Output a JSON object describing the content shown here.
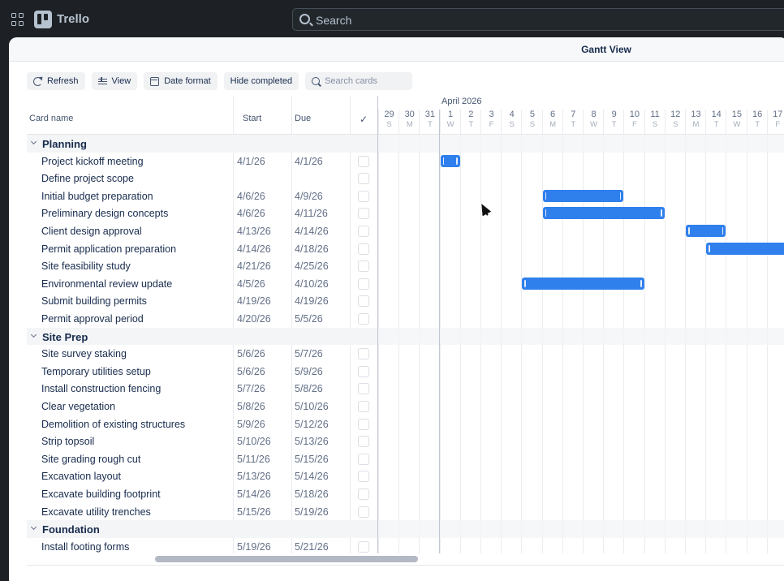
{
  "app": {
    "name": "Trello",
    "search_label": "Search"
  },
  "modal": {
    "title": "Gantt View"
  },
  "toolbar": {
    "refresh": "Refresh",
    "view": "View",
    "date_format": "Date format",
    "hide_completed": "Hide completed",
    "search_placeholder": "Search cards"
  },
  "table": {
    "headers": {
      "name": "Card name",
      "start": "Start",
      "due": "Due",
      "done": "✓"
    },
    "rows": [
      {
        "type": "group",
        "name": "Planning"
      },
      {
        "type": "card",
        "name": "Project kickoff meeting",
        "start": "4/1/26",
        "due": "4/1/26"
      },
      {
        "type": "card",
        "name": "Define project scope",
        "start": "",
        "due": ""
      },
      {
        "type": "card",
        "name": "Initial budget preparation",
        "start": "4/6/26",
        "due": "4/9/26"
      },
      {
        "type": "card",
        "name": "Preliminary design concepts",
        "start": "4/6/26",
        "due": "4/11/26"
      },
      {
        "type": "card",
        "name": "Client design approval",
        "start": "4/13/26",
        "due": "4/14/26"
      },
      {
        "type": "card",
        "name": "Permit application preparation",
        "start": "4/14/26",
        "due": "4/18/26"
      },
      {
        "type": "card",
        "name": "Site feasibility study",
        "start": "4/21/26",
        "due": "4/25/26"
      },
      {
        "type": "card",
        "name": "Environmental review update",
        "start": "4/5/26",
        "due": "4/10/26"
      },
      {
        "type": "card",
        "name": "Submit building permits",
        "start": "4/19/26",
        "due": "4/19/26"
      },
      {
        "type": "card",
        "name": "Permit approval period",
        "start": "4/20/26",
        "due": "5/5/26"
      },
      {
        "type": "group",
        "name": "Site Prep"
      },
      {
        "type": "card",
        "name": "Site survey staking",
        "start": "5/6/26",
        "due": "5/7/26"
      },
      {
        "type": "card",
        "name": "Temporary utilities setup",
        "start": "5/6/26",
        "due": "5/9/26"
      },
      {
        "type": "card",
        "name": "Install construction fencing",
        "start": "5/7/26",
        "due": "5/8/26"
      },
      {
        "type": "card",
        "name": "Clear vegetation",
        "start": "5/8/26",
        "due": "5/10/26"
      },
      {
        "type": "card",
        "name": "Demolition of existing structures",
        "start": "5/9/26",
        "due": "5/12/26"
      },
      {
        "type": "card",
        "name": "Strip topsoil",
        "start": "5/10/26",
        "due": "5/13/26"
      },
      {
        "type": "card",
        "name": "Site grading rough cut",
        "start": "5/11/26",
        "due": "5/15/26"
      },
      {
        "type": "card",
        "name": "Excavation layout",
        "start": "5/13/26",
        "due": "5/14/26"
      },
      {
        "type": "card",
        "name": "Excavate building footprint",
        "start": "5/14/26",
        "due": "5/18/26"
      },
      {
        "type": "card",
        "name": "Excavate utility trenches",
        "start": "5/15/26",
        "due": "5/19/26"
      },
      {
        "type": "group",
        "name": "Foundation"
      },
      {
        "type": "card",
        "name": "Install footing forms",
        "start": "5/19/26",
        "due": "5/21/26"
      }
    ]
  },
  "gantt": {
    "month_label": "April 2026",
    "days": [
      {
        "num": "29",
        "letter": "S"
      },
      {
        "num": "30",
        "letter": "M"
      },
      {
        "num": "31",
        "letter": "T"
      },
      {
        "num": "1",
        "letter": "W"
      },
      {
        "num": "2",
        "letter": "T"
      },
      {
        "num": "3",
        "letter": "F"
      },
      {
        "num": "4",
        "letter": "S"
      },
      {
        "num": "5",
        "letter": "S"
      },
      {
        "num": "6",
        "letter": "M"
      },
      {
        "num": "7",
        "letter": "T"
      },
      {
        "num": "8",
        "letter": "W"
      },
      {
        "num": "9",
        "letter": "T"
      },
      {
        "num": "10",
        "letter": "F"
      },
      {
        "num": "11",
        "letter": "S"
      },
      {
        "num": "12",
        "letter": "S"
      },
      {
        "num": "13",
        "letter": "M"
      },
      {
        "num": "14",
        "letter": "T"
      },
      {
        "num": "15",
        "letter": "W"
      },
      {
        "num": "16",
        "letter": "T"
      },
      {
        "num": "17",
        "letter": "F"
      }
    ],
    "bar_color": "#2f80ed"
  }
}
